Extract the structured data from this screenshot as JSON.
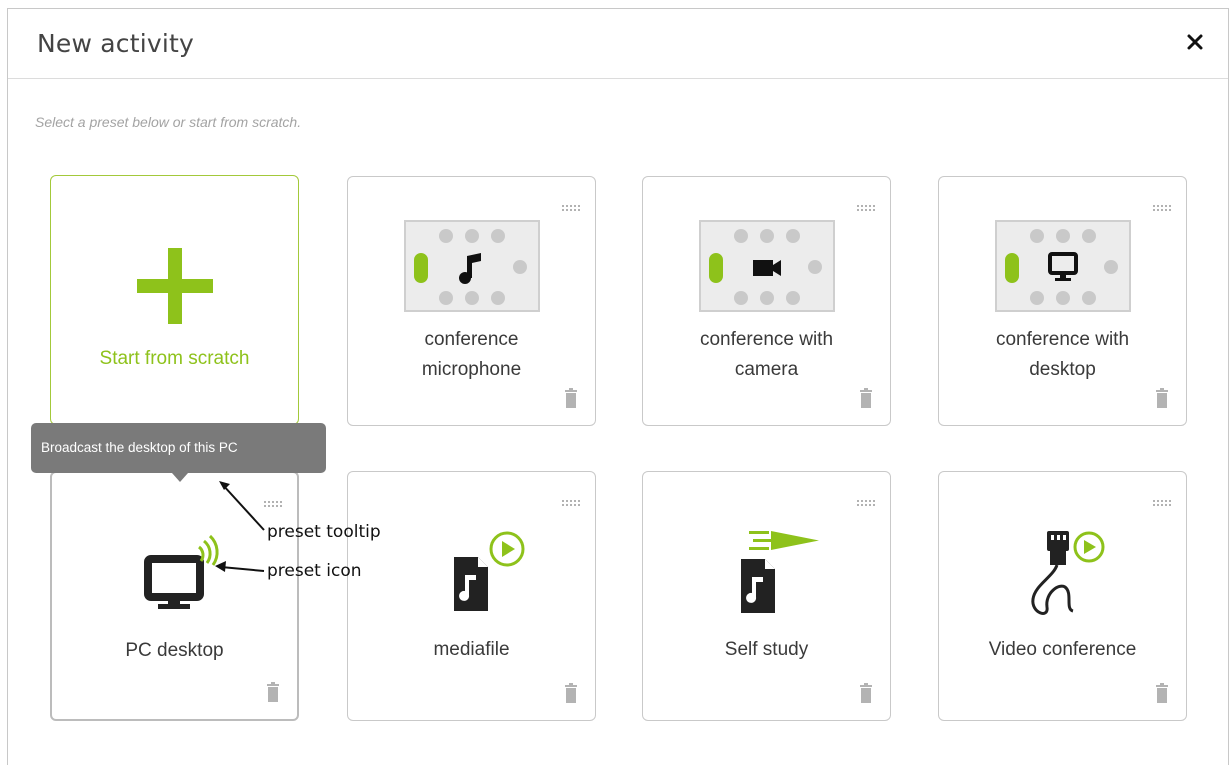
{
  "dialog": {
    "title": "New activity",
    "subtitle": "Select a preset below or start from scratch."
  },
  "presets": [
    {
      "label": "Start from scratch",
      "icon": "plus-icon"
    },
    {
      "label_line1": "conference",
      "label_line2": "microphone",
      "icon": "conference-microphone-icon"
    },
    {
      "label_line1": "conference with",
      "label_line2": "camera",
      "icon": "conference-camera-icon"
    },
    {
      "label_line1": "conference with",
      "label_line2": "desktop",
      "icon": "conference-desktop-icon"
    },
    {
      "label": "PC desktop",
      "icon": "pc-desktop-broadcast-icon"
    },
    {
      "label": "mediafile",
      "icon": "mediafile-play-icon"
    },
    {
      "label": "Self study",
      "icon": "self-study-icon"
    },
    {
      "label": "Video conference",
      "icon": "video-conference-icon"
    }
  ],
  "tooltip": {
    "text": "Broadcast the desktop of this PC"
  },
  "annotations": {
    "tooltip_label": "preset tooltip",
    "icon_label": "preset icon"
  },
  "colors": {
    "accent": "#8ec21b",
    "tooltip_bg": "#7a7a7a",
    "border": "#c9c9c9",
    "icon_dark": "#222222",
    "trash": "#b3b3b3"
  }
}
